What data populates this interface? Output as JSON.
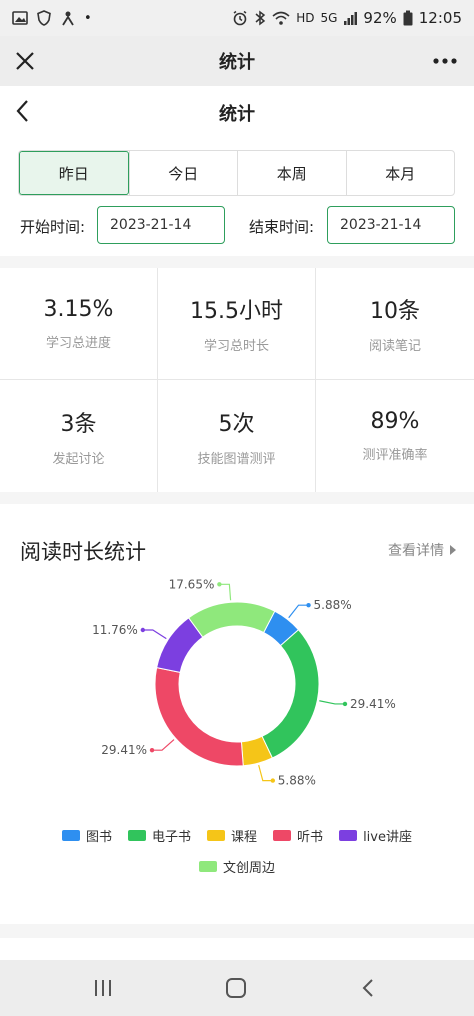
{
  "status_bar": {
    "dot": "•",
    "hd": "HD",
    "net": "5G",
    "battery": "92%",
    "time": "12:05"
  },
  "wx_bar": {
    "title": "统计"
  },
  "nav": {
    "title": "统计"
  },
  "filter": {
    "tabs": [
      "昨日",
      "今日",
      "本周",
      "本月"
    ],
    "active_tab": "昨日",
    "start_label": "开始时间:",
    "start_value": "2023-21-14",
    "end_label": "结束时间:",
    "end_value": "2023-21-14"
  },
  "stats": [
    {
      "value": "3.15%",
      "label": "学习总进度"
    },
    {
      "value": "15.5小时",
      "label": "学习总时长"
    },
    {
      "value": "10条",
      "label": "阅读笔记"
    },
    {
      "value": "3条",
      "label": "发起讨论"
    },
    {
      "value": "5次",
      "label": "技能图谱测评"
    },
    {
      "value": "89%",
      "label": "测评准确率"
    }
  ],
  "reading": {
    "title": "阅读时长统计",
    "detail_link": "查看详情"
  },
  "chart_data": {
    "type": "pie",
    "donut": true,
    "title": "",
    "legend_position": "bottom",
    "series": [
      {
        "name": "图书",
        "value": 5.88,
        "label": "5.88%",
        "color": "#2e8ff0"
      },
      {
        "name": "电子书",
        "value": 29.41,
        "label": "29.41%",
        "color": "#31c45c"
      },
      {
        "name": "课程",
        "value": 5.88,
        "label": "5.88%",
        "color": "#f5c518"
      },
      {
        "name": "听书",
        "value": 29.41,
        "label": "29.41%",
        "color": "#ee4866"
      },
      {
        "name": "live讲座",
        "value": 11.76,
        "label": "11.76%",
        "color": "#7c3fe0"
      },
      {
        "name": "文创周边",
        "value": 17.65,
        "label": "17.65%",
        "color": "#8fe87c"
      }
    ]
  }
}
